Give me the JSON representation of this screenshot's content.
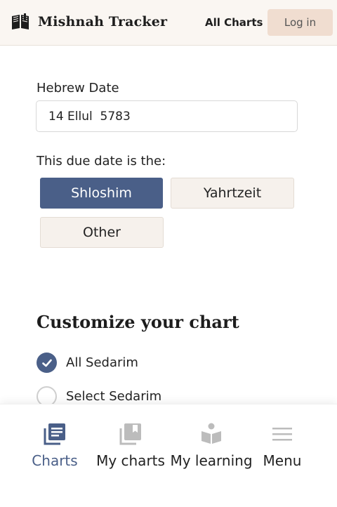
{
  "header": {
    "app_name": "Mishnah Tracker",
    "nav_all_charts": "All Charts",
    "login_label": "Log in"
  },
  "form": {
    "hebrew_date_label": "Hebrew Date",
    "hebrew_date_value": "14 Ellul  5783",
    "due_label": "This due date is the:",
    "choices": [
      "Shloshim",
      "Yahrtzeit",
      "Other"
    ],
    "selected_choice": "Shloshim"
  },
  "customize": {
    "title": "Customize your chart",
    "options": [
      "All Sedarim",
      "Select Sedarim"
    ],
    "selected_option": "All Sedarim"
  },
  "bottom_nav": {
    "items": [
      {
        "label": "Charts",
        "icon": "charts-icon",
        "active": true
      },
      {
        "label": "My charts",
        "icon": "my-charts-icon",
        "active": false
      },
      {
        "label": "My learning",
        "icon": "reading-icon",
        "active": false
      },
      {
        "label": "Menu",
        "icon": "menu-icon",
        "active": false
      }
    ]
  },
  "colors": {
    "accent": "#4a5f88",
    "header_bg": "#faf6f2",
    "login_bg": "#f0ddd0",
    "choice_bg": "#f6f1ec",
    "icon_gray": "#bcbcbc"
  }
}
